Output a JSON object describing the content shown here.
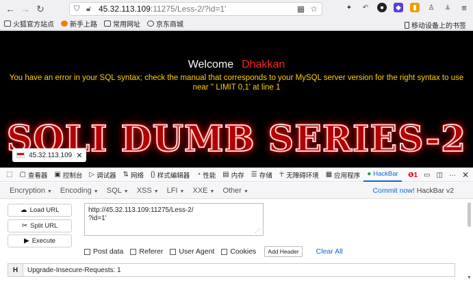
{
  "browser": {
    "url_host": "45.32.113.109",
    "url_rest": ":11275/Less-2/?id=1'"
  },
  "bookmarks": {
    "items": [
      "火狐官方站点",
      "新手上路",
      "常用网址",
      "京东商城"
    ],
    "right": "移动设备上的书签"
  },
  "page": {
    "welcome": "Welcome",
    "user": "Dhakkan",
    "error": "You have an error in your SQL syntax; check the manual that corresponds to your MySQL server version for the right syntax to use near '' LIMIT 0,1' at line 1",
    "banner": "SQLI DUMB SERIES-2",
    "tab_host": "45.32.113.109"
  },
  "devtools": {
    "tabs": [
      "查看器",
      "控制台",
      "调试器",
      "网络",
      "样式编辑器",
      "性能",
      "内存",
      "存储",
      "无障碍环境",
      "应用程序",
      "HackBar"
    ],
    "error_count": "1"
  },
  "hackbar": {
    "menus": [
      "Encryption",
      "Encoding",
      "SQL",
      "XSS",
      "LFI",
      "XXE",
      "Other"
    ],
    "commit": "Commit now!",
    "version": "HackBar v2",
    "load_url": "Load URL",
    "split_url": "Split URL",
    "execute": "Execute",
    "url_value": "http://45.32.113.109:11275/Less-2/\n?id=1'",
    "post_data": "Post data",
    "referer": "Referer",
    "user_agent": "User Agent",
    "cookies": "Cookies",
    "add_header": "Add Header",
    "clear_all": "Clear All",
    "header_label": "H",
    "header_value": "Upgrade-Insecure-Requests: 1"
  },
  "colors": {
    "error_text": "#ffd200",
    "username": "#ff2020",
    "link": "#0b64d6",
    "banner": "#b30000"
  }
}
